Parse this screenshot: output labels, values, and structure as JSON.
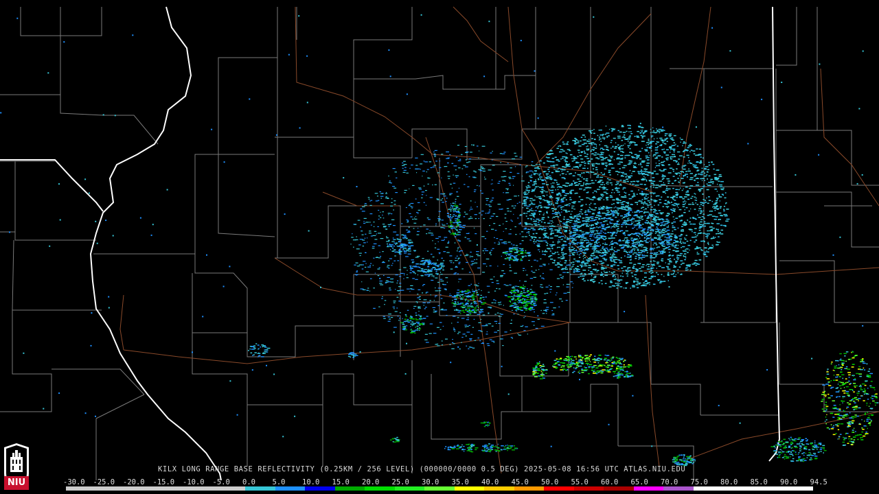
{
  "caption": "KILX LONG RANGE BASE REFLECTIVITY (0.25KM / 256 LEVEL) (000000/0000 0.5 DEG) 2025-05-08 16:56 UTC  ATLAS.NIU.EDU",
  "logo": {
    "text": "NIU",
    "color": "#c8102e"
  },
  "colors": {
    "state_border": "#ffffff",
    "county_line": "#7a7a7a",
    "highway": "#8a4a2a",
    "background": "#000000"
  },
  "legend": {
    "labels": [
      "-30.0",
      "-25.0",
      "-20.0",
      "-15.0",
      "-10.0",
      "-5.0",
      "0.0",
      "5.0",
      "10.0",
      "15.0",
      "20.0",
      "25.0",
      "30.0",
      "35.0",
      "40.0",
      "45.0",
      "50.0",
      "55.0",
      "60.0",
      "65.0",
      "70.0",
      "75.0",
      "80.0",
      "85.0",
      "90.0",
      "94.5"
    ],
    "colors": [
      "#cccccc",
      "#cccccc",
      "#cccccc",
      "#cccccc",
      "#cccccc",
      "#cccccc",
      "#36c6d6",
      "#1e90ff",
      "#0000ee",
      "#00aa00",
      "#00dd00",
      "#22ee22",
      "#66ff33",
      "#ffff00",
      "#ffcc00",
      "#ff9900",
      "#ff0000",
      "#cc0000",
      "#aa0000",
      "#ff00ff",
      "#aa55cc",
      "#ffffff",
      "#ffffff",
      "#ffffff",
      "#ffffff"
    ]
  }
}
